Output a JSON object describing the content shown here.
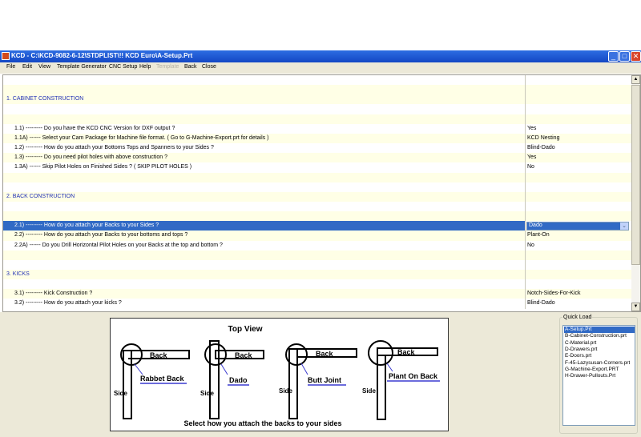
{
  "window": {
    "title": "KCD  -  C:\\KCD-9082-6-12\\STDPLIST\\!! KCD Euro\\A-Setup.Prt",
    "minimize_label": "_",
    "maximize_label": "□",
    "close_label": "✕"
  },
  "menu": [
    "File",
    "Edit",
    "View",
    "Template Generator",
    "CNC Setup",
    "Help",
    "Template",
    "Back",
    "Close"
  ],
  "grid": {
    "rows": [
      {
        "q": "",
        "a": "",
        "bg": "w"
      },
      {
        "q": "",
        "a": "",
        "bg": "y"
      },
      {
        "q": "1.  CABINET CONSTRUCTION",
        "a": "",
        "bg": "y",
        "header": true
      },
      {
        "q": "",
        "a": "",
        "bg": "w"
      },
      {
        "q": "",
        "a": "",
        "bg": "y"
      },
      {
        "q": "1.1) ---------    Do you have the KCD CNC Version for DXF output ?",
        "a": "Yes",
        "bg": "w"
      },
      {
        "q": "1.1A) ------    Select your Cam Package for Machine file format.  ( Go to G-Machine-Export.prt for details )",
        "a": "KCD Nesting",
        "bg": "y"
      },
      {
        "q": "1.2) ---------    How do you attach your Bottoms Tops and Spanners to your Sides ?",
        "a": "Blind-Dado",
        "bg": "w"
      },
      {
        "q": "1.3) ---------    Do you need pilot holes with above construction ?",
        "a": "Yes",
        "bg": "y"
      },
      {
        "q": "1.3A) ------    Skip Pilot Holes on Finished Sides ? ( SKIP PILOT HOLES )",
        "a": "No",
        "bg": "w"
      },
      {
        "q": "",
        "a": "",
        "bg": "y"
      },
      {
        "q": "",
        "a": "",
        "bg": "w"
      },
      {
        "q": "2.  BACK CONSTRUCTION",
        "a": "",
        "bg": "y",
        "header": true
      },
      {
        "q": "",
        "a": "",
        "bg": "w"
      },
      {
        "q": "",
        "a": "",
        "bg": "y"
      },
      {
        "q": "2.1) ---------    How do you attach your Backs to your Sides ?",
        "a": "Dado",
        "bg": "w",
        "selected": true
      },
      {
        "q": "2.2) ---------    How do you attach your Backs to your bottoms and tops ?",
        "a": "Plant-On",
        "bg": "y"
      },
      {
        "q": "2.2A) ------    Do you Drill Horizontal Pilot Holes on your Backs at the top and bottom ?",
        "a": "No",
        "bg": "w"
      },
      {
        "q": "",
        "a": "",
        "bg": "y"
      },
      {
        "q": "",
        "a": "",
        "bg": "w"
      },
      {
        "q": "3.  KICKS",
        "a": "",
        "bg": "y",
        "header": true
      },
      {
        "q": "",
        "a": "",
        "bg": "w"
      },
      {
        "q": "3.1) ---------    Kick Construction ?",
        "a": "Notch-Sides-For-Kick",
        "bg": "y"
      },
      {
        "q": "3.2) ---------    How do you attach your kicks ?",
        "a": "Blind-Dado",
        "bg": "w"
      }
    ],
    "dropdown_arrow": "⌄",
    "scroll_up": "▲",
    "scroll_down": "▼"
  },
  "diagram": {
    "title": "Top View",
    "caption": "Select how you attach the backs to your sides",
    "back_label": "Back",
    "side_label": "Side",
    "options": [
      "Rabbet Back",
      "Dado",
      "Butt Joint",
      "Plant On Back"
    ]
  },
  "quick_load": {
    "label": "Quick Load",
    "items": [
      "A-Setup.Prt",
      "B-Cabinet-Construction.prt",
      "C-Material.prt",
      "D-Drawers.prt",
      "E-Doors.prt",
      "F-45-Lazysusan-Corners.prt",
      "G-Machine-Export.PRT",
      "H-Drawer-Pullouts.Prt"
    ],
    "selected_index": 0
  },
  "colors": {
    "selection": "#316ac5",
    "header_text": "#2332b5",
    "row_alt": "#ffffe6",
    "legend_underline": "#3b3bd0"
  }
}
